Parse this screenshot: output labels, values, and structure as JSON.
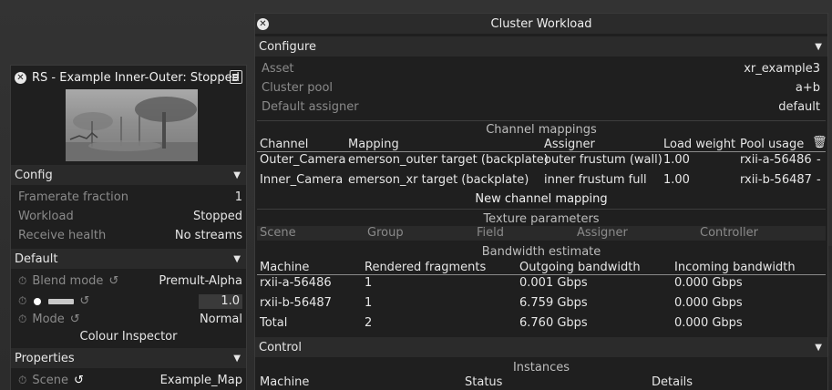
{
  "left_panel": {
    "title": "RS - Example Inner-Outer: Stopped",
    "config": {
      "header": "Config",
      "rows": [
        {
          "label": "Framerate fraction",
          "value": "1"
        },
        {
          "label": "Workload",
          "value": "Stopped"
        },
        {
          "label": "Receive health",
          "value": "No streams"
        }
      ]
    },
    "default": {
      "header": "Default",
      "blend_mode_label": "Blend mode",
      "blend_mode_value": "Premult-Alpha",
      "brightness_value": "1.0",
      "mode_label": "Mode",
      "mode_value": "Normal",
      "colour_inspector": "Colour Inspector"
    },
    "properties": {
      "header": "Properties",
      "scene_label": "Scene",
      "scene_value": "Example_Map"
    }
  },
  "cluster": {
    "title": "Cluster Workload",
    "configure": {
      "header": "Configure",
      "asset_label": "Asset",
      "asset_value": "xr_example3",
      "pool_label": "Cluster pool",
      "pool_value": "a+b",
      "assigner_label": "Default assigner",
      "assigner_value": "default"
    },
    "channel_mappings": {
      "title": "Channel mappings",
      "columns": [
        "Channel",
        "Mapping",
        "Assigner",
        "Load weight",
        "Pool usage"
      ],
      "rows": [
        {
          "channel": "Outer_Camera",
          "mapping": "emerson_outer target (backplate)",
          "assigner": "outer frustum (wall)",
          "weight": "1.00",
          "pool": "rxii-a-56486",
          "dash": "-"
        },
        {
          "channel": "Inner_Camera",
          "mapping": "emerson_xr target (backplate)",
          "assigner": "inner frustum full",
          "weight": "1.00",
          "pool": "rxii-b-56487",
          "dash": "-"
        }
      ],
      "new_button": "New channel mapping"
    },
    "texture": {
      "title": "Texture parameters",
      "columns": [
        "Scene",
        "Group",
        "Field",
        "Assigner",
        "Controller"
      ]
    },
    "bandwidth": {
      "title": "Bandwidth estimate",
      "columns": [
        "Machine",
        "Rendered fragments",
        "Outgoing bandwidth",
        "Incoming bandwidth"
      ],
      "rows": [
        {
          "machine": "rxii-a-56486",
          "fragments": "1",
          "out": "0.001 Gbps",
          "in": "0.000 Gbps"
        },
        {
          "machine": "rxii-b-56487",
          "fragments": "1",
          "out": "6.759 Gbps",
          "in": "0.000 Gbps"
        },
        {
          "machine": "Total",
          "fragments": "2",
          "out": "6.760 Gbps",
          "in": "0.000 Gbps"
        }
      ]
    },
    "control": {
      "header": "Control",
      "instances_title": "Instances",
      "columns": [
        "Machine",
        "Status",
        "Details"
      ]
    }
  }
}
